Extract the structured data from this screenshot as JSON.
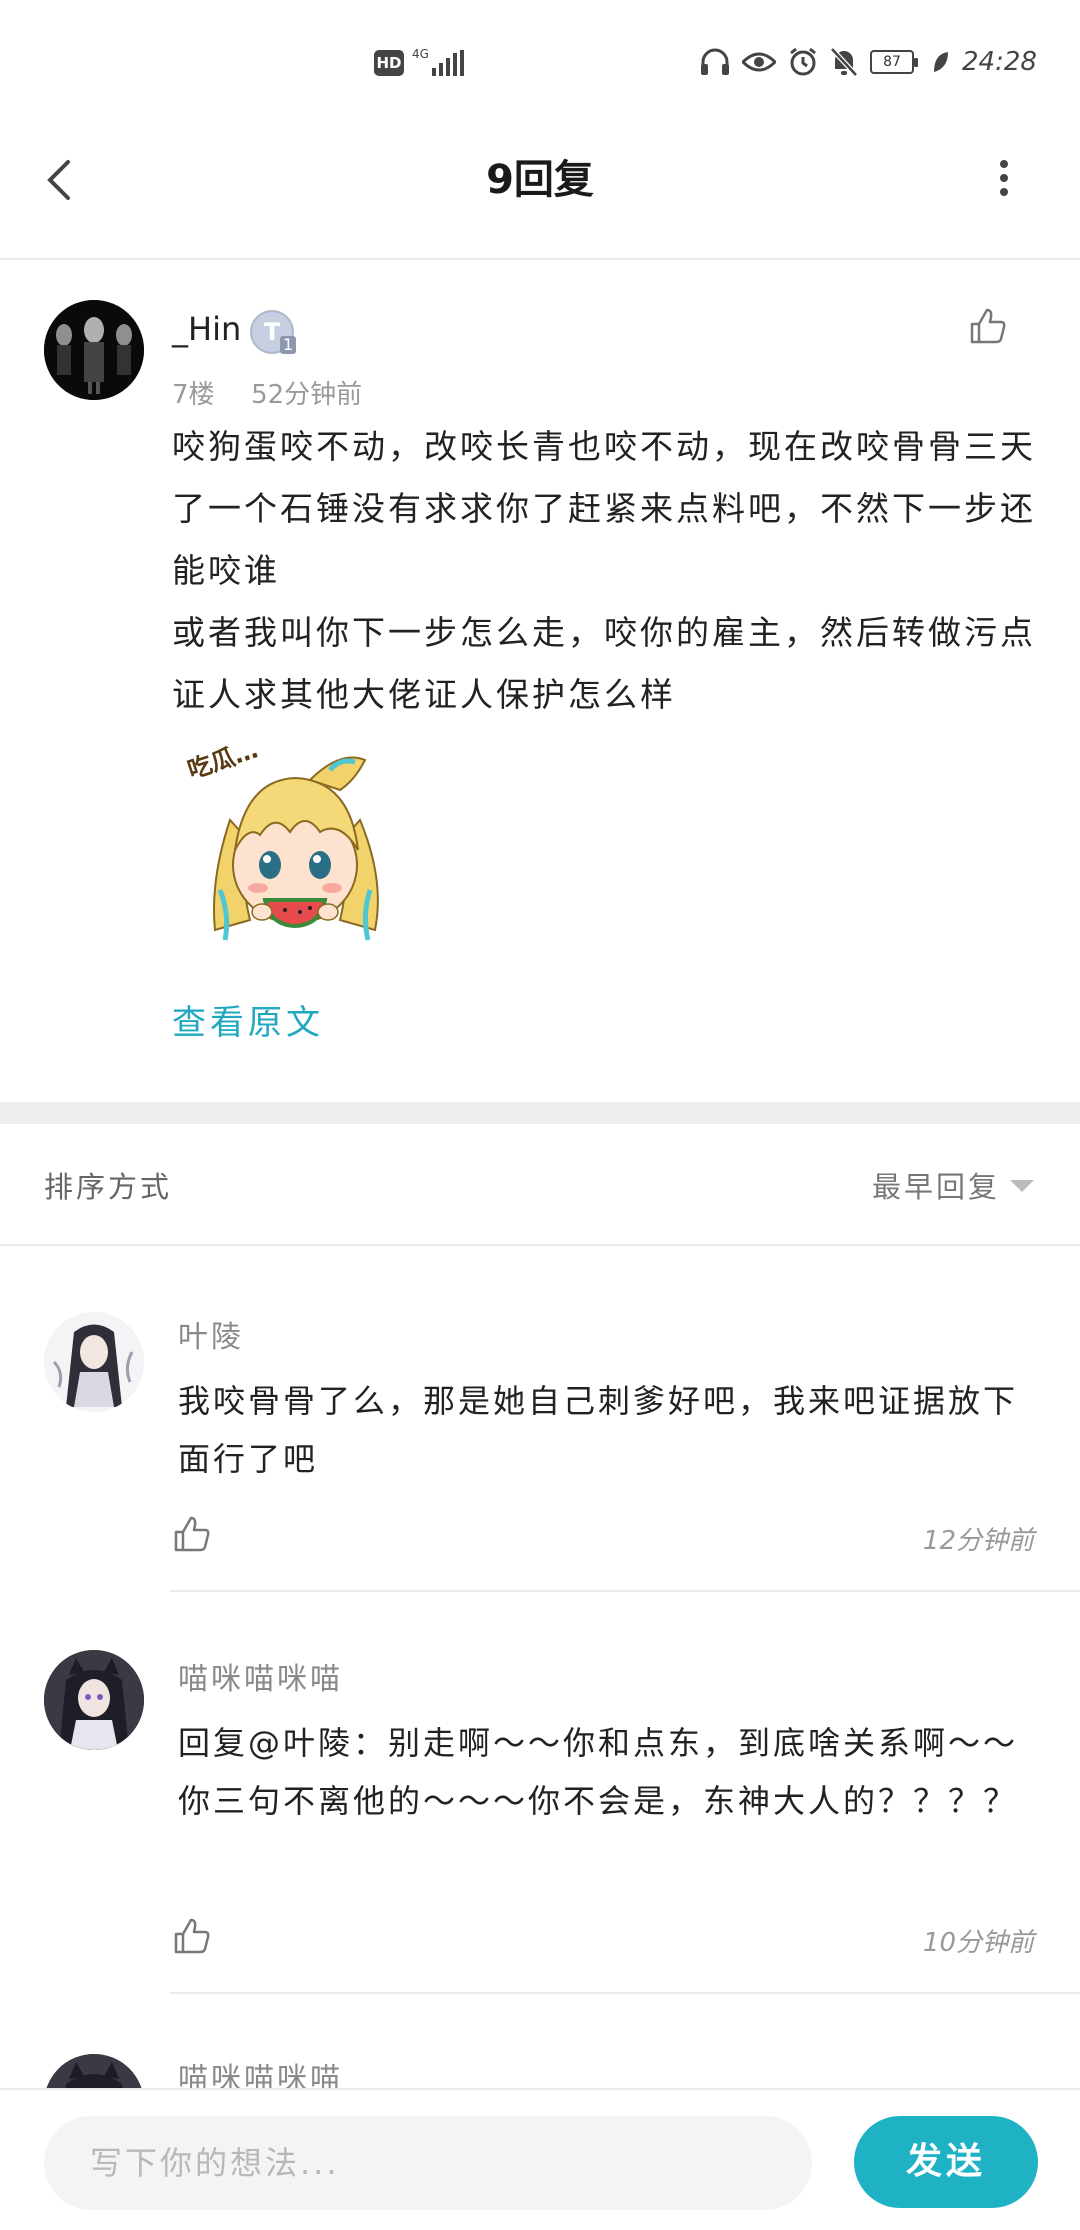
{
  "status_bar": {
    "hd": "HD",
    "network": "4G",
    "battery": "87",
    "time": "24:28",
    "icons": [
      "headphones-icon",
      "eye-icon",
      "alarm-icon",
      "mute-icon",
      "battery-icon",
      "leaf-icon"
    ]
  },
  "header": {
    "title": "9回复"
  },
  "post": {
    "username": "_Hin",
    "badge": "T",
    "badge_level": "1",
    "floor": "7楼",
    "time_ago": "52分钟前",
    "paragraphs": [
      "咬狗蛋咬不动，改咬长青也咬不动，现在改咬骨骨三天了一个石锤没有求求你了赶紧来点料吧，不然下一步还能咬谁",
      "或者我叫你下一步怎么走，咬你的雇主，然后转做污点证人求其他大佬证人保护怎么样"
    ],
    "sticker_text": "吃瓜…",
    "view_original": "查看原文"
  },
  "sort": {
    "label": "排序方式",
    "value": "最早回复"
  },
  "replies": [
    {
      "name": "叶陵",
      "text": "我咬骨骨了么，那是她自己刺爹好吧，我来吧证据放下面行了吧",
      "time": "12分钟前"
    },
    {
      "name": "喵咪喵咪喵",
      "text": "回复@叶陵：别走啊～～你和点东，到底啥关系啊～～你三句不离他的～～～你不会是，东神大人的？？？？",
      "time": "10分钟前"
    },
    {
      "name": "喵咪喵咪喵"
    }
  ],
  "bottom": {
    "placeholder": "写下你的想法...",
    "send": "发送"
  },
  "colors": {
    "accent": "#1fb2c5",
    "link": "#1fa8bf"
  }
}
